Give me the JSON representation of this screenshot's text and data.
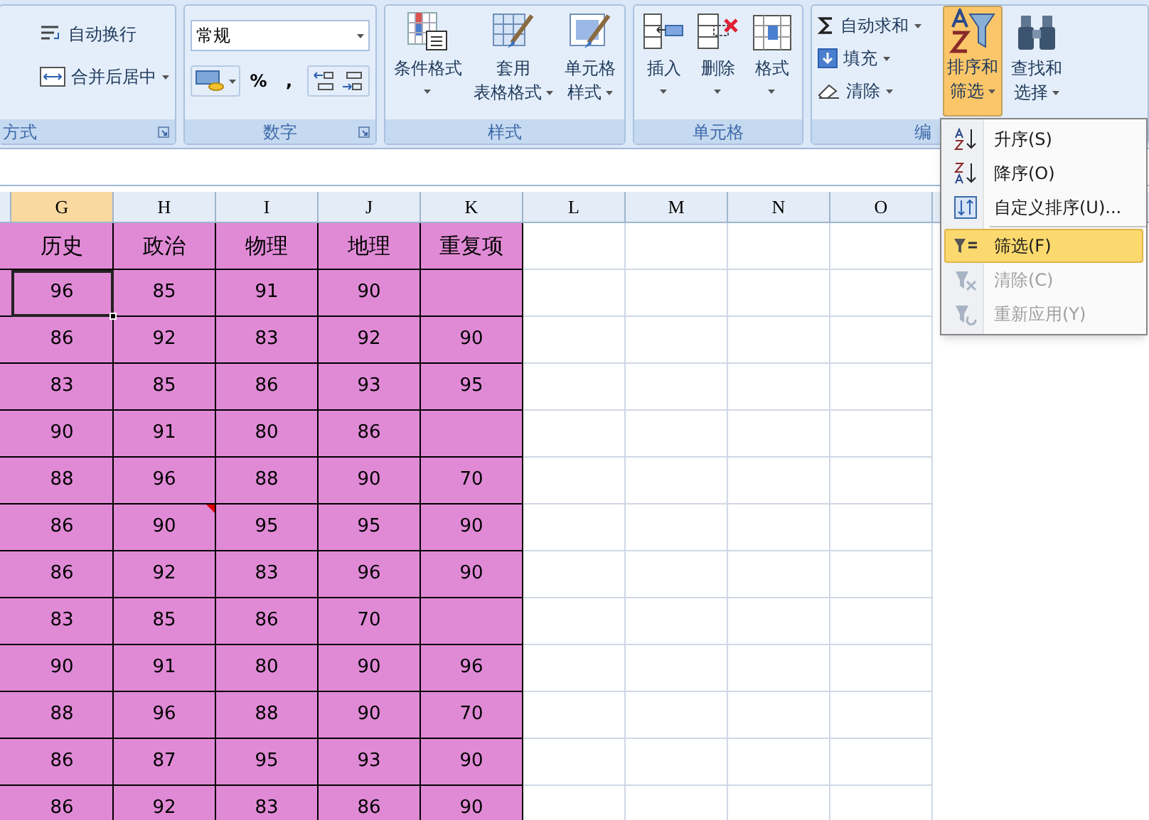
{
  "ribbon": {
    "groups": [
      {
        "kind": "alignment",
        "label": "方式",
        "buttons": [
          {
            "label": "自动换行",
            "dropdown": false
          },
          {
            "label": "合并后居中",
            "dropdown": true
          }
        ]
      },
      {
        "kind": "number",
        "label": "数字",
        "format": "常规",
        "buttons": [
          "%",
          ","
        ]
      },
      {
        "kind": "large",
        "label": "样式",
        "buttons": [
          {
            "lines": [
              "条件格式"
            ],
            "dropdown": true
          },
          {
            "lines": [
              "套用",
              "表格格式"
            ],
            "dropdown": true
          },
          {
            "lines": [
              "单元格",
              "样式"
            ],
            "dropdown": true
          }
        ]
      },
      {
        "kind": "large",
        "label": "单元格",
        "buttons": [
          {
            "lines": [
              "插入"
            ],
            "dropdown": true
          },
          {
            "lines": [
              "删除"
            ],
            "dropdown": true
          },
          {
            "lines": [
              "格式"
            ],
            "dropdown": true
          }
        ]
      },
      {
        "kind": "editing",
        "label": "编",
        "small": [
          {
            "label": "自动求和",
            "dropdown": true
          },
          {
            "label": "填充",
            "dropdown": true
          },
          {
            "label": "清除",
            "dropdown": true
          }
        ],
        "large": [
          {
            "lines": [
              "排序和",
              "筛选"
            ],
            "dropdown": true,
            "selected": true
          },
          {
            "lines": [
              "查找和",
              "选择"
            ],
            "dropdown": true,
            "selected": false
          }
        ]
      }
    ]
  },
  "menu": {
    "items": [
      {
        "kind": "asc",
        "label": "升序(S)",
        "selected": false,
        "disabled": false
      },
      {
        "kind": "desc",
        "label": "降序(O)",
        "selected": false,
        "disabled": false
      },
      {
        "kind": "custom",
        "label": "自定义排序(U)...",
        "selected": false,
        "disabled": false
      },
      {
        "kind": "filter",
        "label": "筛选(F)",
        "selected": true,
        "disabled": false
      },
      {
        "kind": "clear",
        "label": "清除(C)",
        "selected": false,
        "disabled": true
      },
      {
        "kind": "reapply",
        "label": "重新应用(Y)",
        "selected": false,
        "disabled": true
      }
    ]
  },
  "sheet": {
    "columns": [
      {
        "label": "G",
        "selected": true
      },
      {
        "label": "H",
        "selected": false
      },
      {
        "label": "I",
        "selected": false
      },
      {
        "label": "J",
        "selected": false
      },
      {
        "label": "K",
        "selected": false
      },
      {
        "label": "L",
        "selected": false
      },
      {
        "label": "M",
        "selected": false
      },
      {
        "label": "N",
        "selected": false
      },
      {
        "label": "O",
        "selected": false
      }
    ],
    "rows": [
      {
        "cells": [
          {
            "text": "历史",
            "selected": false,
            "comment": false
          },
          {
            "text": "政治",
            "selected": false,
            "comment": false
          },
          {
            "text": "物理",
            "selected": false,
            "comment": false
          },
          {
            "text": "地理",
            "selected": false,
            "comment": false
          },
          {
            "text": "重复项",
            "selected": false,
            "comment": false
          }
        ]
      },
      {
        "cells": [
          {
            "text": "96",
            "selected": true,
            "comment": false
          },
          {
            "text": "85",
            "selected": false,
            "comment": false
          },
          {
            "text": "91",
            "selected": false,
            "comment": false
          },
          {
            "text": "90",
            "selected": false,
            "comment": false
          },
          {
            "selected": false,
            "comment": false
          }
        ]
      },
      {
        "cells": [
          {
            "text": "86",
            "selected": false,
            "comment": false
          },
          {
            "text": "92",
            "selected": false,
            "comment": false
          },
          {
            "text": "83",
            "selected": false,
            "comment": false
          },
          {
            "text": "92",
            "selected": false,
            "comment": false
          },
          {
            "text": "90",
            "selected": false,
            "comment": false
          }
        ]
      },
      {
        "cells": [
          {
            "text": "83",
            "selected": false,
            "comment": false
          },
          {
            "text": "85",
            "selected": false,
            "comment": false
          },
          {
            "text": "86",
            "selected": false,
            "comment": false
          },
          {
            "text": "93",
            "selected": false,
            "comment": false
          },
          {
            "text": "95",
            "selected": false,
            "comment": false
          }
        ]
      },
      {
        "cells": [
          {
            "text": "90",
            "selected": false,
            "comment": false
          },
          {
            "text": "91",
            "selected": false,
            "comment": false
          },
          {
            "text": "80",
            "selected": false,
            "comment": false
          },
          {
            "text": "86",
            "selected": false,
            "comment": false
          },
          {
            "selected": false,
            "comment": false
          }
        ]
      },
      {
        "cells": [
          {
            "text": "88",
            "selected": false,
            "comment": false
          },
          {
            "text": "96",
            "selected": false,
            "comment": false
          },
          {
            "text": "88",
            "selected": false,
            "comment": false
          },
          {
            "text": "90",
            "selected": false,
            "comment": false
          },
          {
            "text": "70",
            "selected": false,
            "comment": false
          }
        ]
      },
      {
        "cells": [
          {
            "text": "86",
            "selected": false,
            "comment": false
          },
          {
            "text": "90",
            "selected": false,
            "comment": true
          },
          {
            "text": "95",
            "selected": false,
            "comment": false
          },
          {
            "text": "95",
            "selected": false,
            "comment": false
          },
          {
            "text": "90",
            "selected": false,
            "comment": false
          }
        ]
      },
      {
        "cells": [
          {
            "text": "86",
            "selected": false,
            "comment": false
          },
          {
            "text": "92",
            "selected": false,
            "comment": false
          },
          {
            "text": "83",
            "selected": false,
            "comment": false
          },
          {
            "text": "96",
            "selected": false,
            "comment": false
          },
          {
            "text": "90",
            "selected": false,
            "comment": false
          }
        ]
      },
      {
        "cells": [
          {
            "text": "83",
            "selected": false,
            "comment": false
          },
          {
            "text": "85",
            "selected": false,
            "comment": false
          },
          {
            "text": "86",
            "selected": false,
            "comment": false
          },
          {
            "text": "70",
            "selected": false,
            "comment": false
          },
          {
            "selected": false,
            "comment": false
          }
        ]
      },
      {
        "cells": [
          {
            "text": "90",
            "selected": false,
            "comment": false
          },
          {
            "text": "91",
            "selected": false,
            "comment": false
          },
          {
            "text": "80",
            "selected": false,
            "comment": false
          },
          {
            "text": "90",
            "selected": false,
            "comment": false
          },
          {
            "text": "96",
            "selected": false,
            "comment": false
          }
        ]
      },
      {
        "cells": [
          {
            "text": "88",
            "selected": false,
            "comment": false
          },
          {
            "text": "96",
            "selected": false,
            "comment": false
          },
          {
            "text": "88",
            "selected": false,
            "comment": false
          },
          {
            "text": "90",
            "selected": false,
            "comment": false
          },
          {
            "text": "70",
            "selected": false,
            "comment": false
          }
        ]
      },
      {
        "cells": [
          {
            "text": "86",
            "selected": false,
            "comment": false
          },
          {
            "text": "87",
            "selected": false,
            "comment": false
          },
          {
            "text": "95",
            "selected": false,
            "comment": false
          },
          {
            "text": "93",
            "selected": false,
            "comment": false
          },
          {
            "text": "90",
            "selected": false,
            "comment": false
          }
        ]
      },
      {
        "cells": [
          {
            "text": "86",
            "selected": false,
            "comment": false
          },
          {
            "text": "92",
            "selected": false,
            "comment": false
          },
          {
            "text": "83",
            "selected": false,
            "comment": false
          },
          {
            "text": "86",
            "selected": false,
            "comment": false
          },
          {
            "text": "90",
            "selected": false,
            "comment": false
          }
        ]
      }
    ]
  }
}
